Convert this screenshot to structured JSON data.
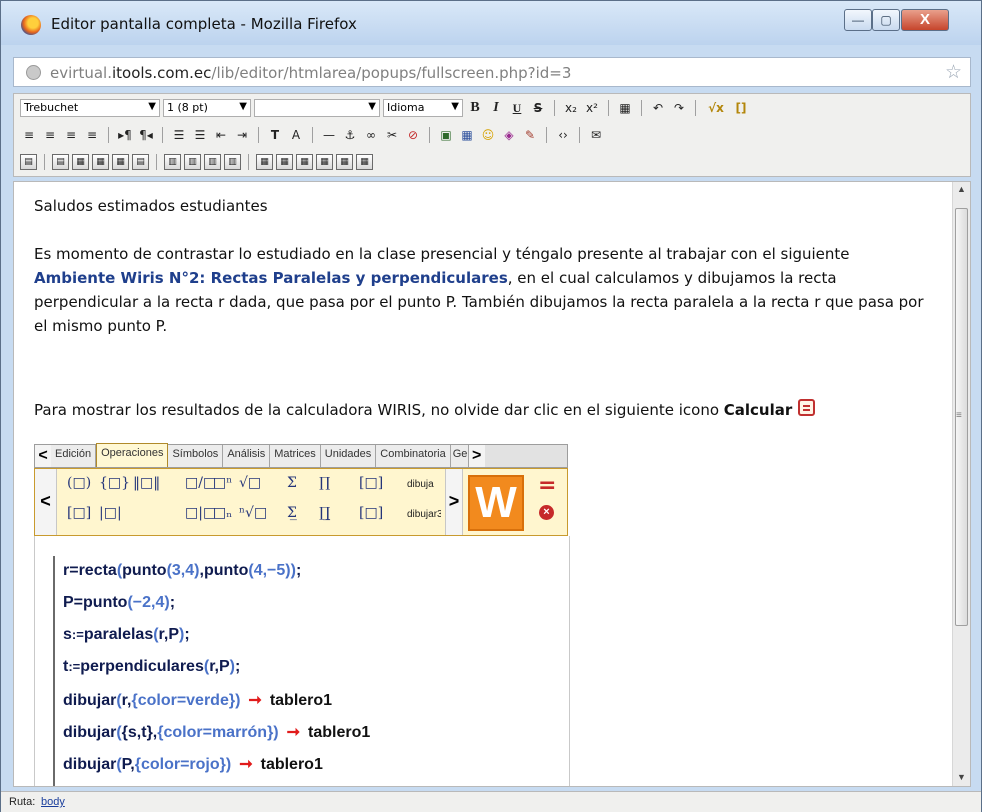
{
  "window": {
    "title": "Editor pantalla completa - Mozilla Firefox",
    "min_label": "—",
    "max_label": "▢",
    "close_label": "X"
  },
  "address": {
    "prefix": "evirtual.",
    "domain": "itools.com.ec",
    "path": "/lib/editor/htmlarea/popups/fullscreen.php?id=3"
  },
  "toolbar": {
    "font": "Trebuchet",
    "size": "1 (8 pt)",
    "format": "",
    "language": "Idioma",
    "bold": "B",
    "italic": "I",
    "underline": "U",
    "strike": "S",
    "row1_icons": [
      "x₂",
      "x²",
      "▦",
      "↶",
      "↷"
    ],
    "wiris_icon": "√x",
    "row2_icons": [
      "≡",
      "≡",
      "≡",
      "≡",
      "▸¶",
      "¶◂",
      "☰",
      "☰",
      "⇤",
      "⇥",
      "T",
      "A",
      "—",
      "⚓",
      "∞",
      "✂",
      "⊘",
      "▣",
      "▦",
      "☺",
      "◈",
      "✎",
      "‹›",
      "✉"
    ],
    "row3_icons": [
      "▤",
      "▤",
      "▦",
      "▦",
      "▦",
      "▤",
      "▥",
      "▥",
      "▥",
      "▥",
      "▦",
      "▦",
      "▦",
      "▦",
      "▦",
      "▦"
    ]
  },
  "content": {
    "greeting": "Saludos estimados estudiantes",
    "para1_before": "Es momento de contrastar lo estudiado en la clase presencial y téngalo presente al trabajar con el siguiente ",
    "para1_link": "Ambiente Wiris N°2: Rectas Paralelas y perpendiculares",
    "para1_after": ", en el cual calculamos y dibujamos la recta perpendicular a la recta r dada, que pasa por el punto P. También dibujamos la recta paralela a la recta r que pasa por el mismo punto P.",
    "para2_before": "Para mostrar los resultados de la calculadora WIRIS, no olvide dar clic en el siguiente icono ",
    "para2_bold": "Calcular"
  },
  "wiris": {
    "tabs": [
      "Edición",
      "Operaciones",
      "Símbolos",
      "Análisis",
      "Matrices",
      "Unidades",
      "Combinatoria",
      "Ge"
    ],
    "active_tab": "Operaciones",
    "palette": {
      "row1": [
        "(□)",
        "{□}",
        "‖□‖",
        "□/□",
        "□ⁿ",
        "√□",
        "Σ",
        "∏",
        "[□]",
        "dibuja"
      ],
      "row2": [
        "[□]",
        "|□|",
        "□|□",
        "□ₙ",
        "ⁿ√□",
        "Σ̲",
        "∏̲",
        "[□]",
        "dibujar3"
      ]
    },
    "logo": "W",
    "calc_symbol": "=",
    "clear_symbol": "×",
    "code": [
      {
        "parts": [
          "r=recta",
          "(",
          "punto",
          "(",
          "3,4",
          ")",
          ",",
          "punto",
          "(",
          "4,",
          "−5",
          "))",
          ";"
        ]
      },
      {
        "parts": [
          "P=punto",
          "(",
          "−2,4",
          ")",
          ";"
        ]
      },
      {
        "parts": [
          "s",
          ":=",
          "paralelas",
          "(",
          "r,P",
          ")",
          ";"
        ]
      },
      {
        "parts": [
          "t",
          ":=",
          "perpendiculares",
          "(",
          "r,P",
          ")",
          ";"
        ]
      },
      {
        "parts": [
          "dibujar",
          "(",
          "r,",
          "{color=verde}",
          ")"
        ],
        "arrow": "➞",
        "board": "tablero1"
      },
      {
        "parts": [
          "dibujar",
          "(",
          "{s,t}",
          ",",
          "{color=marrón}",
          ")"
        ],
        "arrow": "➞",
        "board": "tablero1"
      },
      {
        "parts": [
          "dibujar",
          "(",
          "P,",
          "{color=rojo}",
          ")"
        ],
        "arrow": "➞",
        "board": "tablero1"
      }
    ]
  },
  "status": {
    "label": "Ruta:",
    "path": "body"
  }
}
